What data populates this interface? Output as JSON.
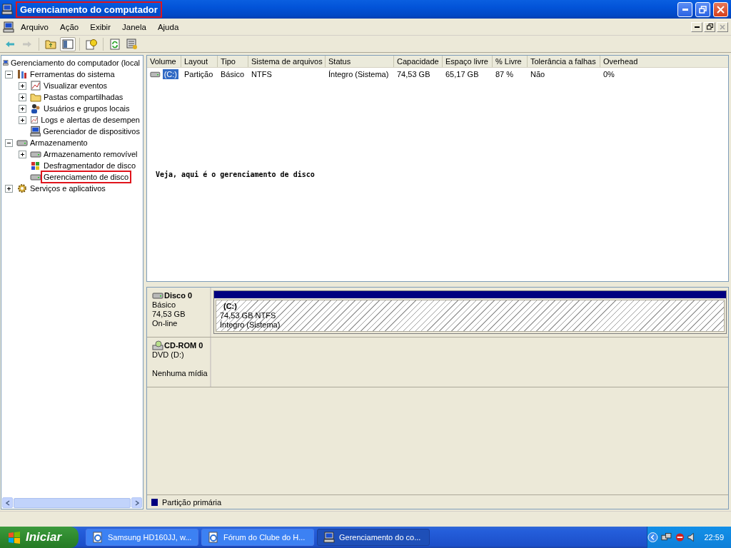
{
  "window": {
    "title": "Gerenciamento do computador",
    "title_highlighted": true
  },
  "menu": [
    "Arquivo",
    "Ação",
    "Exibir",
    "Janela",
    "Ajuda"
  ],
  "toolbar": [
    {
      "kind": "back",
      "disabled": false,
      "pressed": false
    },
    {
      "kind": "forward",
      "disabled": true,
      "pressed": false
    },
    {
      "kind": "sep"
    },
    {
      "kind": "up",
      "disabled": false,
      "pressed": false
    },
    {
      "kind": "pane",
      "disabled": false,
      "pressed": true
    },
    {
      "kind": "sep"
    },
    {
      "kind": "help",
      "disabled": false,
      "pressed": false
    },
    {
      "kind": "sep"
    },
    {
      "kind": "refresh",
      "disabled": false,
      "pressed": false
    },
    {
      "kind": "props",
      "disabled": false,
      "pressed": false
    }
  ],
  "tree": {
    "label": "Gerenciamento do computador (local",
    "children": [
      {
        "label": "Ferramentas do sistema",
        "expanded": true,
        "highlighted": false,
        "children": [
          {
            "label": "Visualizar eventos",
            "expanded": false,
            "highlighted": false
          },
          {
            "label": "Pastas compartilhadas",
            "expanded": false,
            "highlighted": false
          },
          {
            "label": "Usuários e grupos locais",
            "expanded": false,
            "highlighted": false
          },
          {
            "label": "Logs e alertas de desempen",
            "expanded": false,
            "highlighted": false
          },
          {
            "label": "Gerenciador de dispositivos",
            "highlighted": false
          }
        ]
      },
      {
        "label": "Armazenamento",
        "expanded": true,
        "highlighted": false,
        "children": [
          {
            "label": "Armazenamento removível",
            "expanded": false,
            "highlighted": false
          },
          {
            "label": "Desfragmentador de disco",
            "highlighted": false
          },
          {
            "label": "Gerenciamento de disco",
            "highlighted": true
          }
        ]
      },
      {
        "label": "Serviços e aplicativos",
        "expanded": false,
        "highlighted": false
      }
    ]
  },
  "volume_table": {
    "columns": [
      "Volume",
      "Layout",
      "Tipo",
      "Sistema de arquivos",
      "Status",
      "Capacidade",
      "Espaço livre",
      "% Livre",
      "Tolerância a falhas",
      "Overhead"
    ],
    "rows": [
      {
        "selected": true,
        "cells": [
          "(C:)",
          "Partição",
          "Básico",
          "NTFS",
          "Íntegro (Sistema)",
          "74,53 GB",
          "65,17 GB",
          "87 %",
          "Não",
          "0%"
        ]
      }
    ]
  },
  "annotation": "Veja, aqui é o gerenciamento de disco",
  "disks": [
    {
      "kind": "disk",
      "name": "Disco 0",
      "type": "Básico",
      "size": "74,53 GB",
      "status": "On-line",
      "partitions": [
        {
          "label": "(C:)",
          "size": "74,53 GB NTFS",
          "status": "Íntegro (Sistema)",
          "color": "#000080"
        }
      ]
    },
    {
      "kind": "cdrom",
      "name": "CD-ROM 0",
      "type": "DVD (D:)",
      "status": "Nenhuma mídia"
    }
  ],
  "legend": [
    {
      "label": "Partição primária",
      "color": "#000080"
    }
  ],
  "taskbar": {
    "start": "Iniciar",
    "tasks": [
      {
        "label": "Samsung HD160JJ, w...",
        "kind": "browser",
        "selected": false
      },
      {
        "label": "Fórum do Clube do H...",
        "kind": "browser",
        "selected": false
      },
      {
        "label": "Gerenciamento do co...",
        "kind": "computer",
        "selected": true
      }
    ],
    "clock": "22:59"
  }
}
